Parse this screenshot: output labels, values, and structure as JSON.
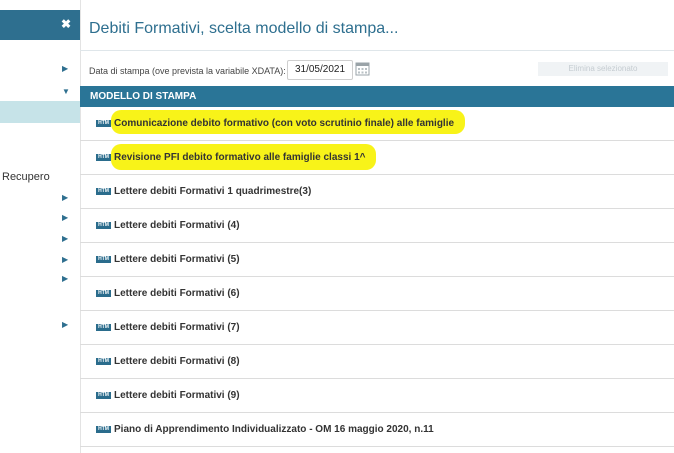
{
  "sidebar": {
    "close_glyph": "✖",
    "section_label": "Recupero"
  },
  "title": "Debiti Formativi, scelta modello di stampa...",
  "date_section": {
    "label": "Data di stampa (ove prevista la variabile XDATA):",
    "value": "31/05/2021",
    "disabled_button": "Elimina selezionato"
  },
  "table": {
    "header": "MODELLO DI STAMPA",
    "icon_text": "HTM",
    "rows": [
      {
        "label": "Comunicazione debito formativo (con voto scrutinio finale) alle famiglie",
        "highlighted": true
      },
      {
        "label": "Revisione PFI debito formativo alle famiglie classi 1^",
        "highlighted": true
      },
      {
        "label": "Lettere debiti Formativi 1 quadrimestre(3)",
        "highlighted": false
      },
      {
        "label": "Lettere debiti Formativi (4)",
        "highlighted": false
      },
      {
        "label": "Lettere debiti Formativi (5)",
        "highlighted": false
      },
      {
        "label": "Lettere debiti Formativi (6)",
        "highlighted": false
      },
      {
        "label": "Lettere debiti Formativi (7)",
        "highlighted": false
      },
      {
        "label": "Lettere debiti Formativi (8)",
        "highlighted": false
      },
      {
        "label": "Lettere debiti Formativi (9)",
        "highlighted": false
      },
      {
        "label": "Piano di Apprendimento Individualizzato - OM 16 maggio 2020, n.11",
        "highlighted": false
      }
    ]
  },
  "colors": {
    "accent": "#2a7597",
    "highlight": "#f7f200",
    "sidebar_selected": "#c6e3e8"
  }
}
